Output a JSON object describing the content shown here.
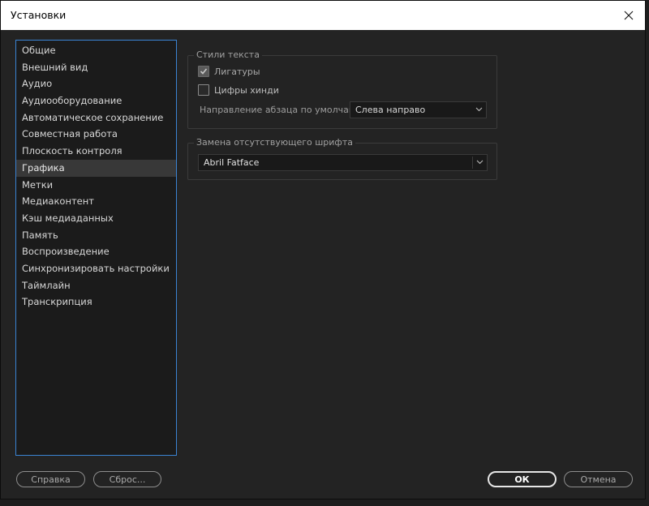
{
  "window": {
    "title": "Установки",
    "close_icon": "close-icon"
  },
  "sidebar": {
    "items": [
      {
        "label": "Общие"
      },
      {
        "label": "Внешний вид"
      },
      {
        "label": "Аудио"
      },
      {
        "label": "Аудиооборудование"
      },
      {
        "label": "Автоматическое сохранение"
      },
      {
        "label": "Совместная работа"
      },
      {
        "label": "Плоскость контроля"
      },
      {
        "label": "Графика",
        "selected": true
      },
      {
        "label": "Метки"
      },
      {
        "label": "Медиаконтент"
      },
      {
        "label": "Кэш медиаданных"
      },
      {
        "label": "Память"
      },
      {
        "label": "Воспроизведение"
      },
      {
        "label": "Синхронизировать настройки"
      },
      {
        "label": "Таймлайн"
      },
      {
        "label": "Транскрипция"
      }
    ]
  },
  "text_styles": {
    "legend": "Стили текста",
    "ligatures": {
      "label": "Лигатуры",
      "checked": true,
      "disabled": true
    },
    "hindi_digits": {
      "label": "Цифры хинди",
      "checked": false
    },
    "paragraph_direction": {
      "label": "Направление абзаца по умолчанию:",
      "value": "Слева направо"
    }
  },
  "missing_font": {
    "legend": "Замена отсутствующего шрифта",
    "value": "Abril Fatface"
  },
  "buttons": {
    "help": "Справка",
    "reset": "Сброс...",
    "ok": "ОК",
    "cancel": "Отмена"
  },
  "colors": {
    "background": "#232323",
    "sidebar_border": "#3a83d3",
    "selected_item": "#383838"
  }
}
